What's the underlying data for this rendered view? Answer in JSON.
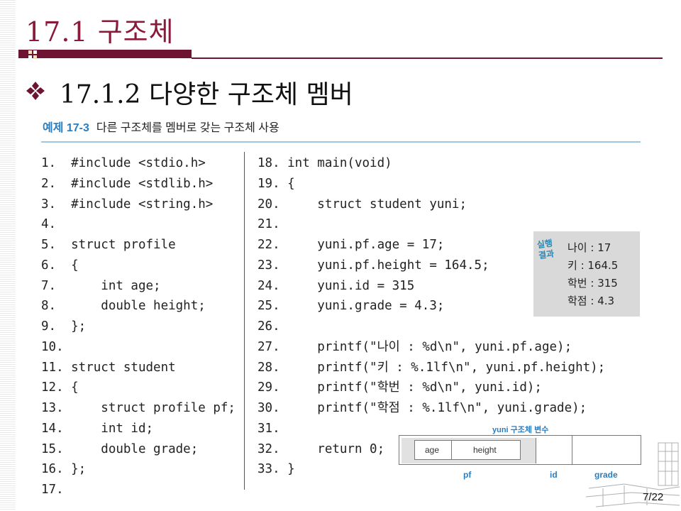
{
  "slide": {
    "title": "17.1 구조체",
    "subheading": "17.1.2 다양한 구조체 멤버",
    "page_number": "7/22"
  },
  "example": {
    "number": "예제 17-3",
    "title": "다른 구조체를 멤버로 갖는 구조체 사용"
  },
  "code_left": [
    "1.  #include <stdio.h>",
    "2.  #include <stdlib.h>",
    "3.  #include <string.h>",
    "4.",
    "5.  struct profile",
    "6.  {",
    "7.      int age;",
    "8.      double height;",
    "9.  };",
    "10.",
    "11. struct student",
    "12. {",
    "13.     struct profile pf;",
    "14.     int id;",
    "15.     double grade;",
    "16. };",
    "17."
  ],
  "code_right": [
    "18. int main(void)",
    "19. {",
    "20.     struct student yuni;",
    "21.",
    "22.     yuni.pf.age = 17;",
    "23.     yuni.pf.height = 164.5;",
    "24.     yuni.id = 315",
    "25.     yuni.grade = 4.3;",
    "26.",
    "27.     printf(\"나이 : %d\\n\", yuni.pf.age);",
    "28.     printf(\"키 : %.1lf\\n\", yuni.pf.height);",
    "29.     printf(\"학번 : %d\\n\", yuni.id);",
    "30.     printf(\"학점 : %.1lf\\n\", yuni.grade);",
    "31.",
    "32.     return 0;",
    "33. }"
  ],
  "result": {
    "tag": "실행 결과",
    "lines": [
      "나이 : 17",
      "키 : 164.5",
      "학번 : 315",
      "학점 : 4.3"
    ]
  },
  "struct_diagram": {
    "caption": "yuni 구조체 변수",
    "inner_fields": [
      "age",
      "height"
    ],
    "labels": [
      "pf",
      "id",
      "grade"
    ]
  },
  "colors": {
    "title": "#8a1a3a",
    "title_bar": "#6e1432",
    "example_accent": "#2a7dbf",
    "result_box": "#d9d9d9"
  },
  "icons": {
    "subheading_bullet": "four-diamond-bullet-icon",
    "title_mark": "small-square-ornament-icon"
  }
}
